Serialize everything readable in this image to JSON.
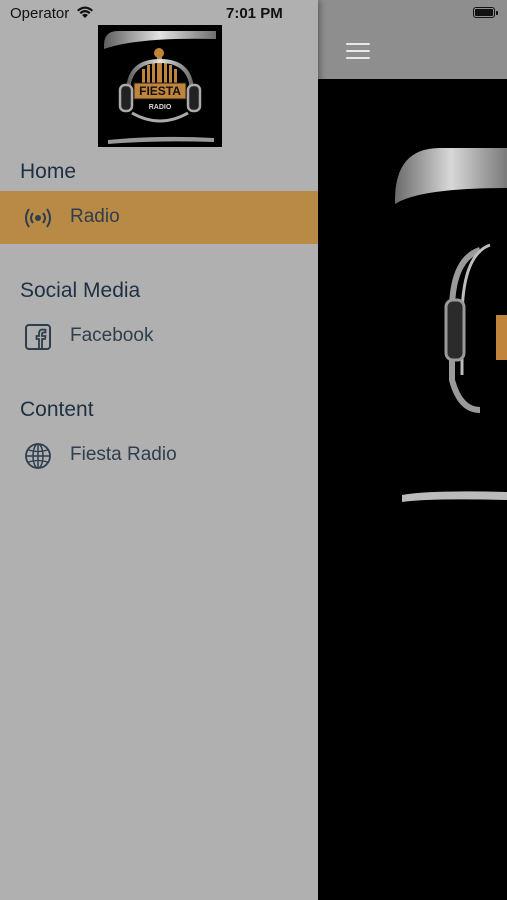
{
  "status_bar": {
    "carrier": "Operator",
    "time": "7:01 PM"
  },
  "logo": {
    "top_text": "FIESTA",
    "bottom_text": "RADIO"
  },
  "menu": {
    "sections": [
      {
        "title": "Home",
        "items": [
          {
            "label": "Radio",
            "icon": "radio-broadcast-icon",
            "active": true
          }
        ]
      },
      {
        "title": "Social Media",
        "items": [
          {
            "label": "Facebook",
            "icon": "facebook-icon",
            "active": false
          }
        ]
      },
      {
        "title": "Content",
        "items": [
          {
            "label": "Fiesta Radio",
            "icon": "globe-icon",
            "active": false
          }
        ]
      }
    ]
  },
  "colors": {
    "drawer_bg": "#b0b0b0",
    "active_item_bg": "#b88a45",
    "topbar_bg": "#8e8e8e",
    "text": "#1f3042"
  }
}
